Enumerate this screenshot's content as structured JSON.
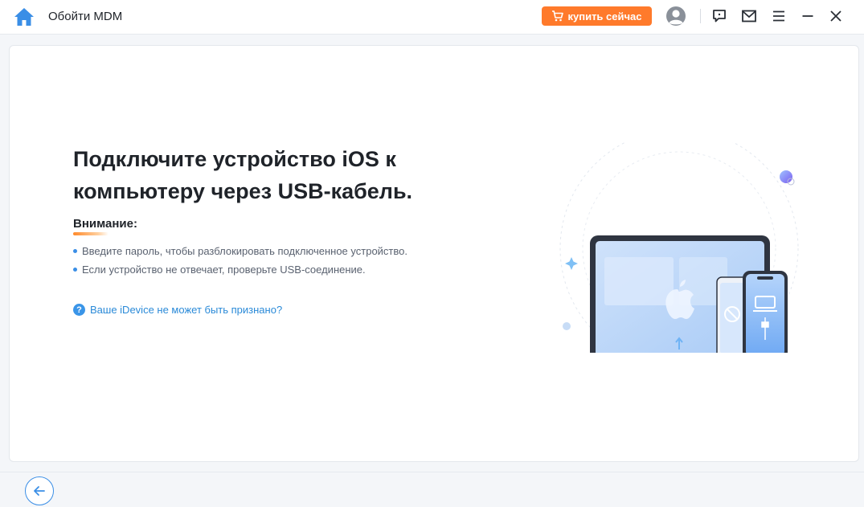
{
  "titlebar": {
    "app_title": "Обойти MDM",
    "buy_label": "купить сейчас"
  },
  "icons": {
    "home": "home-icon",
    "cart": "cart-icon",
    "avatar": "user-avatar-icon",
    "feedback": "chat-icon",
    "mail": "mail-icon",
    "menu": "menu-icon",
    "minimize": "minimize-icon",
    "close": "close-icon",
    "back": "arrow-left-icon",
    "help": "question-icon"
  },
  "colors": {
    "accent_orange": "#ff7a2b",
    "accent_blue": "#3a8ee6"
  },
  "main": {
    "heading": "Подключите устройство iOS к компьютеру через USB-кабель.",
    "attention_title": "Внимание:",
    "bullets": [
      "Введите пароль, чтобы разблокировать подключенное устройство.",
      "Если устройство не отвечает, проверьте USB-соединение."
    ],
    "help_link": "Ваше iDevice не может быть признано?",
    "help_icon_glyph": "?"
  }
}
